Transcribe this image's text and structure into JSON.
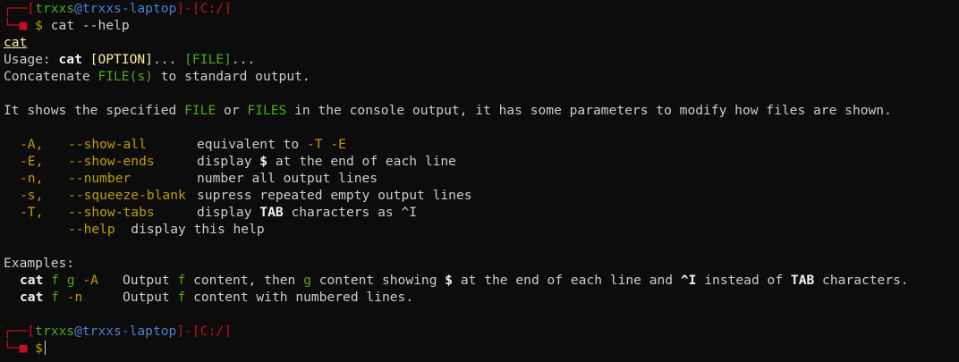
{
  "prompt": {
    "corner_top": "┌──",
    "corner_bottom": "└─",
    "bullet": "■",
    "lbracket": "[",
    "rbracket": "]",
    "user": "trxxs",
    "at": "@",
    "host": "trxxs-laptop",
    "dash": "-",
    "cwd": "C:/",
    "dollar": "$",
    "command": "cat --help"
  },
  "help": {
    "name": "cat",
    "usage_prefix": "Usage: ",
    "usage_cmd": "cat",
    "usage_option": "[OPTION]",
    "usage_mid": "... ",
    "usage_file": "[FILE]",
    "usage_end": "...",
    "concat_pre": "Concatenate ",
    "concat_file": "FILE(s)",
    "concat_post": " to standard output.",
    "desc_pre": "It shows the specified ",
    "desc_file": "FILE",
    "desc_mid": " or ",
    "desc_files": "FILES",
    "desc_post": " in the console output, it has some parameters to modify how files are shown.",
    "options": [
      {
        "short": "-A,",
        "long": "--show-all",
        "desc_pre": "equivalent to ",
        "desc_hl": "-T -E",
        "desc_post": ""
      },
      {
        "short": "-E,",
        "long": "--show-ends",
        "desc_pre": "display ",
        "desc_hl": "$",
        "desc_post": " at the end of each line"
      },
      {
        "short": "-n,",
        "long": "--number",
        "desc_pre": "number all output lines",
        "desc_hl": "",
        "desc_post": ""
      },
      {
        "short": "-s,",
        "long": "--squeeze-blank",
        "desc_pre": "supress repeated empty output lines",
        "desc_hl": "",
        "desc_post": ""
      },
      {
        "short": "-T,",
        "long": "--show-tabs",
        "desc_pre": "display ",
        "desc_hl": "TAB",
        "desc_post": " characters as ^I"
      }
    ],
    "help_flag": "--help",
    "help_desc": "display this help",
    "examples_title": "Examples:",
    "examples": [
      {
        "cmd": "cat",
        "files": "f g",
        "flag": "-A",
        "d1": "Output ",
        "f1": "f",
        "d2": " content, then ",
        "f2": "g",
        "d3": " content showing ",
        "b1": "$",
        "d4": " at the end of each line and ",
        "b2": "^I",
        "d5": " instead of ",
        "b3": "TAB",
        "d6": " characters."
      },
      {
        "cmd": "cat",
        "files": "f",
        "flag": "-n",
        "d1": "Output ",
        "f1": "f",
        "d2": " content with numbered lines."
      }
    ]
  }
}
